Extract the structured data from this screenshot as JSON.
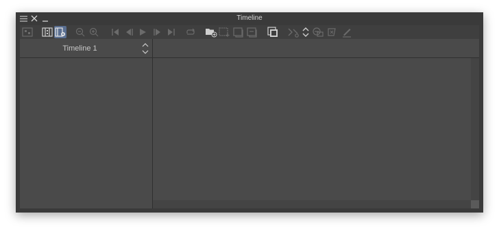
{
  "window": {
    "title": "Timeline"
  },
  "window_controls": [
    {
      "icon": "menu-icon"
    },
    {
      "icon": "close-icon"
    },
    {
      "icon": "minimize-icon"
    }
  ],
  "toolbar": {
    "tools": [
      {
        "icon": "new-timeline-icon",
        "state": "disabled"
      },
      {
        "icon": "onion-skin-icon",
        "state": "normal"
      },
      {
        "icon": "show-cel-icon",
        "state": "active"
      },
      {
        "icon": "zoom-out-icon",
        "state": "disabled"
      },
      {
        "icon": "zoom-in-icon",
        "state": "disabled"
      },
      {
        "icon": "first-frame-icon",
        "state": "disabled"
      },
      {
        "icon": "previous-frame-icon",
        "state": "disabled"
      },
      {
        "icon": "play-icon",
        "state": "disabled"
      },
      {
        "icon": "next-frame-icon",
        "state": "disabled"
      },
      {
        "icon": "last-frame-icon",
        "state": "disabled"
      },
      {
        "icon": "loop-icon",
        "state": "disabled"
      },
      {
        "icon": "new-animation-folder-icon",
        "state": "normal"
      },
      {
        "icon": "new-cel-icon",
        "state": "disabled"
      },
      {
        "icon": "specify-cel-icon",
        "state": "disabled"
      },
      {
        "icon": "clear-cel-icon",
        "state": "disabled"
      },
      {
        "icon": "lightbox-icon",
        "state": "normal"
      },
      {
        "icon": "keyframe-icon",
        "state": "disabled"
      },
      {
        "icon": "stepper-icon",
        "state": "normal"
      },
      {
        "icon": "camerawork-icon",
        "state": "disabled"
      },
      {
        "icon": "remove-keyframe-icon",
        "state": "disabled"
      },
      {
        "icon": "edit-keyframe-icon",
        "state": "disabled"
      }
    ]
  },
  "timeline": {
    "selected": "Timeline 1"
  },
  "colors": {
    "panel_bg": "#3a3a3a",
    "content_bg": "#4a4a4a",
    "active_accent": "#5a6f92",
    "icon_normal": "#cfcfcf",
    "icon_disabled": "#6b6b6b"
  }
}
